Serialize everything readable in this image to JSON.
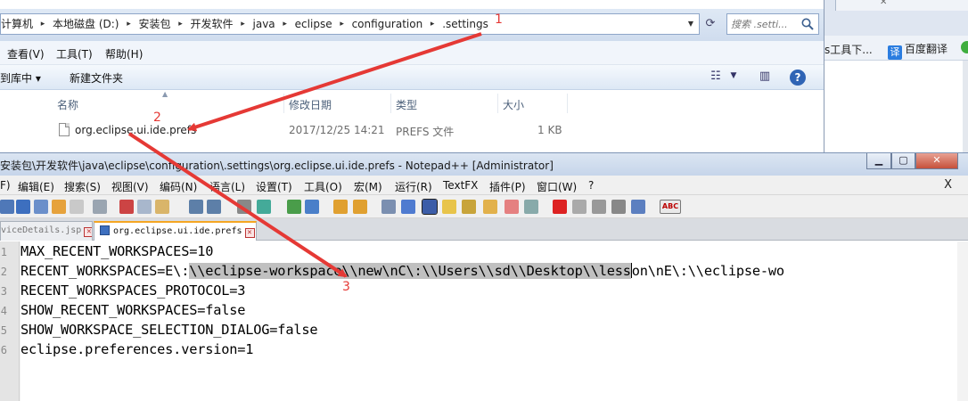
{
  "explorer": {
    "breadcrumbs": [
      "计算机",
      "本地磁盘 (D:)",
      "安装包",
      "开发软件",
      "java",
      "eclipse",
      "configuration",
      ".settings"
    ],
    "search_placeholder": "搜索 .setti...",
    "menu": [
      "查看(V)",
      "工具(T)",
      "帮助(H)"
    ],
    "commands": {
      "include_library": "到库中 ▾",
      "new_folder": "新建文件夹"
    },
    "columns": {
      "name": "名称",
      "modified": "修改日期",
      "type": "类型",
      "size": "大小"
    },
    "file": {
      "name": "org.eclipse.ui.ide.prefs",
      "modified": "2017/12/25 14:21",
      "type": "PREFS 文件",
      "size": "1 KB"
    }
  },
  "browser": {
    "tab_close": "✕",
    "bookmarks": {
      "tools": "s工具下...",
      "translate": "百度翻译",
      "translate_icon": "译"
    }
  },
  "notepad": {
    "title": "安装包\\开发软件\\java\\eclipse\\configuration\\.settings\\org.eclipse.ui.ide.prefs - Notepad++ [Administrator]",
    "menu": [
      "F)",
      "编辑(E)",
      "搜索(S)",
      "视图(V)",
      "编码(N)",
      "语言(L)",
      "设置(T)",
      "工具(O)",
      "宏(M)",
      "运行(R)",
      "TextFX",
      "插件(P)",
      "窗口(W)",
      "?"
    ],
    "close_doc": "X",
    "tabs": [
      {
        "label": "viceDetails.jsp"
      },
      {
        "label": "org.eclipse.ui.ide.prefs"
      }
    ],
    "tab_close": "✕",
    "line_numbers": [
      "1",
      "2",
      "3",
      "4",
      "5",
      "6"
    ],
    "lines": {
      "l1": "MAX_RECENT_WORKSPACES=10",
      "l2_pre": "RECENT_WORKSPACES=E\\:",
      "l2_sel": "\\\\eclipse-workspace\\\\new\\nC\\:\\\\Users\\\\sd\\\\Desktop\\\\less",
      "l2_post": "on\\nE\\:\\\\eclipse-wo",
      "l3": "RECENT_WORKSPACES_PROTOCOL=3",
      "l4": "SHOW_RECENT_WORKSPACES=false",
      "l5": "SHOW_WORKSPACE_SELECTION_DIALOG=false",
      "l6": "eclipse.preferences.version=1"
    }
  },
  "annotations": {
    "a1": "1",
    "a2": "2",
    "a3": "3"
  },
  "colors": {
    "annotation_red": "#e53935",
    "selection": "#c0c0c0",
    "title_gradient": "#c6d5ea"
  }
}
